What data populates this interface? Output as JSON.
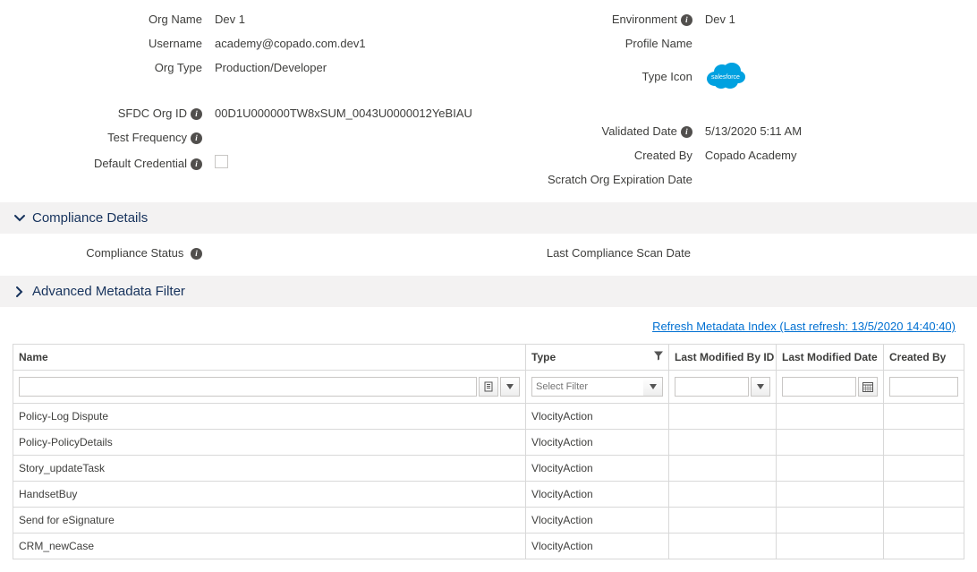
{
  "details": {
    "left": [
      {
        "label": "Org Name",
        "value": "Dev 1",
        "link": true,
        "info": false
      },
      {
        "label": "Username",
        "value": "academy@copado.com.dev1",
        "link": true,
        "info": false
      },
      {
        "label": "Org Type",
        "value": "Production/Developer",
        "link": true,
        "info": false
      },
      {
        "label": "SFDC Org ID",
        "value": "00D1U000000TW8xSUM_0043U0000012YeBIAU",
        "link": true,
        "info": true,
        "gapBefore": true
      },
      {
        "label": "Test Frequency",
        "value": "",
        "link": false,
        "info": true
      },
      {
        "label": "Default Credential",
        "value": "__checkbox__",
        "link": false,
        "info": true
      }
    ],
    "right": [
      {
        "label": "Environment",
        "value": "Dev 1",
        "link": true,
        "info": true
      },
      {
        "label": "Profile Name",
        "value": "",
        "link": false,
        "info": false
      },
      {
        "label": "Type Icon",
        "value": "__sfcloud__",
        "link": false,
        "info": false
      },
      {
        "label": "Validated Date",
        "value": "5/13/2020 5:11 AM",
        "link": true,
        "info": true,
        "gapBefore": true
      },
      {
        "label": "Created By",
        "value": "Copado Academy",
        "link": true,
        "info": false
      },
      {
        "label": "Scratch Org Expiration Date",
        "value": "",
        "link": false,
        "info": false
      }
    ]
  },
  "sections": {
    "compliance_title": "Compliance Details",
    "advanced_title": "Advanced Metadata Filter"
  },
  "compliance": {
    "status_label": "Compliance Status",
    "scan_label": "Last Compliance Scan Date"
  },
  "refresh": {
    "text": "Refresh Metadata Index (Last refresh: 13/5/2020 14:40:40)"
  },
  "table": {
    "headers": {
      "name": "Name",
      "type": "Type",
      "lmbid": "Last Modified By ID",
      "lmd": "Last Modified Date",
      "cb": "Created By"
    },
    "type_filter_placeholder": "Select Filter",
    "rows": [
      {
        "name": "Policy-Log Dispute",
        "type": "VlocityAction",
        "lmbid": "",
        "lmd": "",
        "cb": ""
      },
      {
        "name": "Policy-PolicyDetails",
        "type": "VlocityAction",
        "lmbid": "",
        "lmd": "",
        "cb": ""
      },
      {
        "name": "Story_updateTask",
        "type": "VlocityAction",
        "lmbid": "",
        "lmd": "",
        "cb": ""
      },
      {
        "name": "HandsetBuy",
        "type": "VlocityAction",
        "lmbid": "",
        "lmd": "",
        "cb": ""
      },
      {
        "name": "Send for eSignature",
        "type": "VlocityAction",
        "lmbid": "",
        "lmd": "",
        "cb": ""
      },
      {
        "name": "CRM_newCase",
        "type": "VlocityAction",
        "lmbid": "",
        "lmd": "",
        "cb": ""
      }
    ]
  }
}
